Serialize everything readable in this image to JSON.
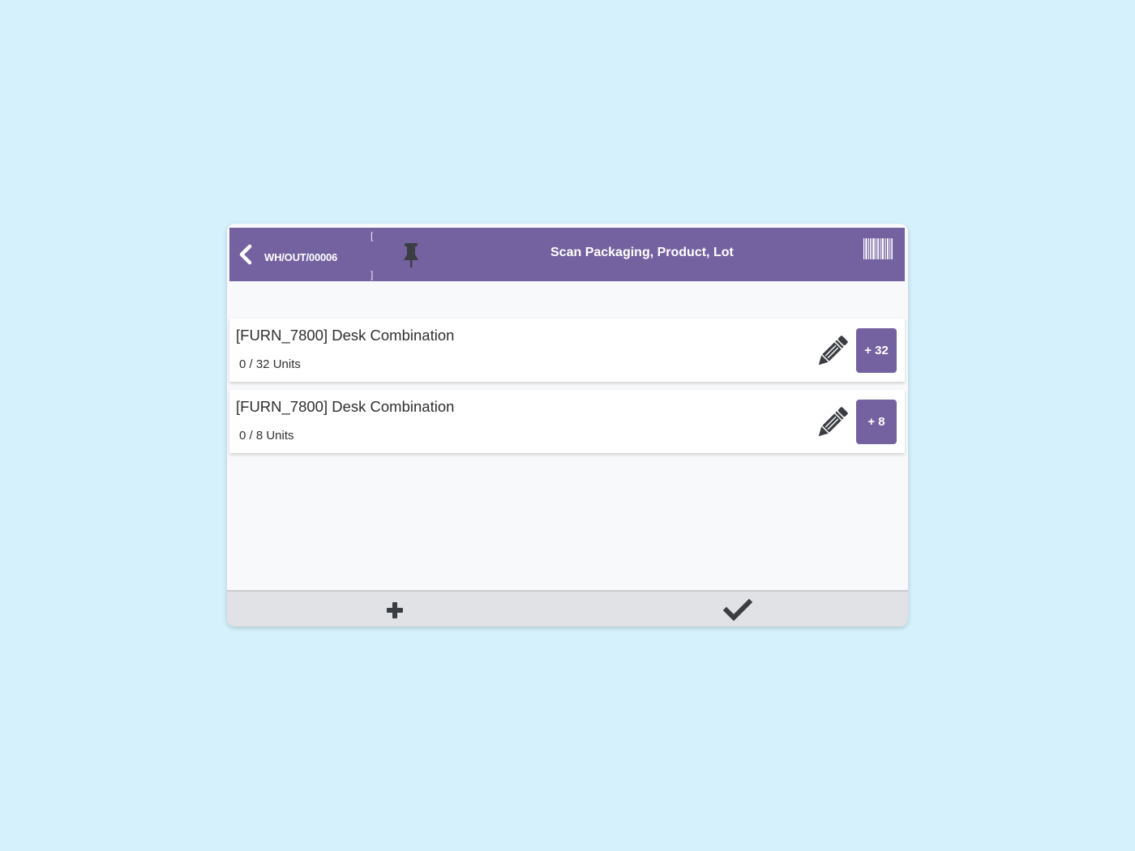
{
  "header": {
    "picking_name": "WH/OUT/00006",
    "bracket_open": "[",
    "bracket_close": "]",
    "scan_instruction": "Scan Packaging, Product, Lot",
    "icons": {
      "back": "chevron-left-icon",
      "pin": "thumbtack-icon",
      "barcode": "barcode-icon"
    }
  },
  "lines": [
    {
      "product": "[FURN_7800] Desk Combination",
      "quantity": "0 / 32 Units",
      "add_label": "+ 32",
      "edit_icon": "pencil-icon"
    },
    {
      "product": "[FURN_7800] Desk Combination",
      "quantity": "0 / 8 Units",
      "add_label": "+ 8",
      "edit_icon": "pencil-icon"
    }
  ],
  "footer": {
    "add_icon": "plus-icon",
    "validate_icon": "check-icon"
  },
  "colors": {
    "primary": "#7461a0",
    "background": "#d5f1fc",
    "icon": "#3a3d42",
    "footer": "#e0e2e5"
  }
}
